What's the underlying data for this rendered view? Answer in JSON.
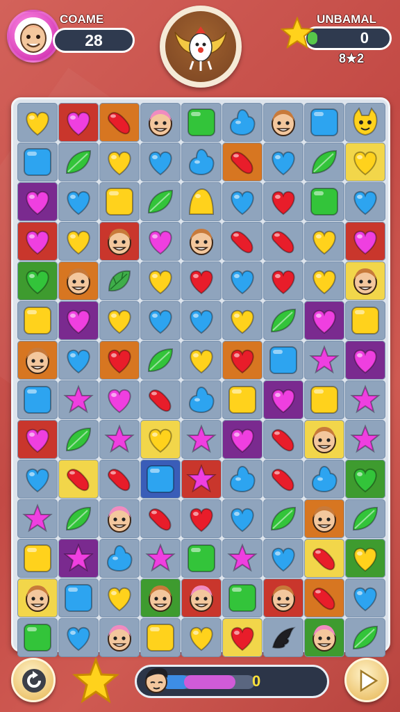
{
  "player_left": {
    "name": "COAME",
    "score": "28"
  },
  "player_right": {
    "name": "UNBAMAL",
    "score": "0",
    "moves": "8★2",
    "progress_fraction": 0.08
  },
  "footer": {
    "progress_value": "0",
    "progress_blue_fraction": 0.3,
    "progress_purple_fraction": 0.55
  },
  "colors": {
    "background": "#c9564f",
    "board": "#dde4ec",
    "cell": "#8fa4bd",
    "yellow": "#ffd21c",
    "red": "#e81d2a",
    "magenta": "#ef3fe0",
    "blue": "#2da4f0",
    "green": "#33c43a",
    "purple": "#b33ae0"
  },
  "board": {
    "cols": 9,
    "rows": [
      [
        "heart-yellow",
        "heart-magenta|red",
        "bean-red|orange",
        "face-pink",
        "square-green",
        "drop-blue",
        "face-tan",
        "square-blue",
        "cat-yellow"
      ],
      [
        "square-blue",
        "leaf-green",
        "heart-yellow",
        "heart-blue",
        "drop-blue",
        "bean-red|orange",
        "heart-blue",
        "leaf-green",
        "heart-yellow|yellow"
      ],
      [
        "heart-magenta|purple",
        "heart-blue",
        "square-yellow",
        "leaf-green",
        "gumdrop-yellow",
        "heart-blue",
        "heart-red",
        "square-green",
        "heart-blue"
      ],
      [
        "heart-magenta|red",
        "heart-yellow",
        "face-tan|red",
        "heart-magenta",
        "face-tan",
        "bean-red",
        "bean-red",
        "heart-yellow",
        "heart-magenta|red"
      ],
      [
        "heart-green|green",
        "face-tan|orange",
        "mint-green",
        "heart-yellow",
        "heart-red",
        "heart-blue",
        "heart-red",
        "heart-yellow",
        "face-tan|yellow"
      ],
      [
        "square-yellow",
        "heart-magenta|purple",
        "heart-yellow",
        "heart-blue",
        "heart-blue",
        "heart-yellow",
        "leaf-green",
        "heart-magenta|purple",
        "square-yellow"
      ],
      [
        "face-tan|orange",
        "heart-blue",
        "heart-red|orange",
        "leaf-green",
        "heart-yellow",
        "heart-red|orange",
        "square-blue",
        "star-magenta",
        "heart-magenta|purple"
      ],
      [
        "square-blue",
        "star-magenta",
        "heart-magenta",
        "bean-red",
        "drop-blue",
        "square-yellow",
        "heart-magenta|purple",
        "square-yellow",
        "star-magenta"
      ],
      [
        "heart-magenta|red",
        "leaf-green",
        "star-magenta",
        "heart-yellow|yellow",
        "star-magenta",
        "heart-magenta|purple",
        "bean-red",
        "face-tan|yellow",
        "star-magenta"
      ],
      [
        "heart-blue",
        "bean-red|yellow",
        "bean-red",
        "square-blue|blue",
        "star-magenta|red",
        "drop-blue",
        "bean-red",
        "drop-blue",
        "heart-green|green"
      ],
      [
        "star-magenta",
        "leaf-green",
        "face-pink",
        "bean-red",
        "heart-red",
        "heart-blue",
        "leaf-green",
        "face-tan|orange",
        "leaf-green"
      ],
      [
        "square-yellow",
        "star-magenta|purple",
        "drop-blue",
        "star-magenta",
        "square-green",
        "star-magenta",
        "heart-blue",
        "bean-red|yellow",
        "heart-yellow|green"
      ],
      [
        "face-tan|yellow",
        "square-blue",
        "heart-yellow",
        "face-tan|green",
        "face-pink|red",
        "square-green",
        "face-tan|red",
        "bean-red|orange",
        "heart-blue"
      ],
      [
        "square-green",
        "heart-blue",
        "face-pink",
        "square-yellow",
        "heart-yellow",
        "heart-red|yellow",
        "wing-dark",
        "face-pink|green",
        "leaf-green"
      ]
    ]
  }
}
